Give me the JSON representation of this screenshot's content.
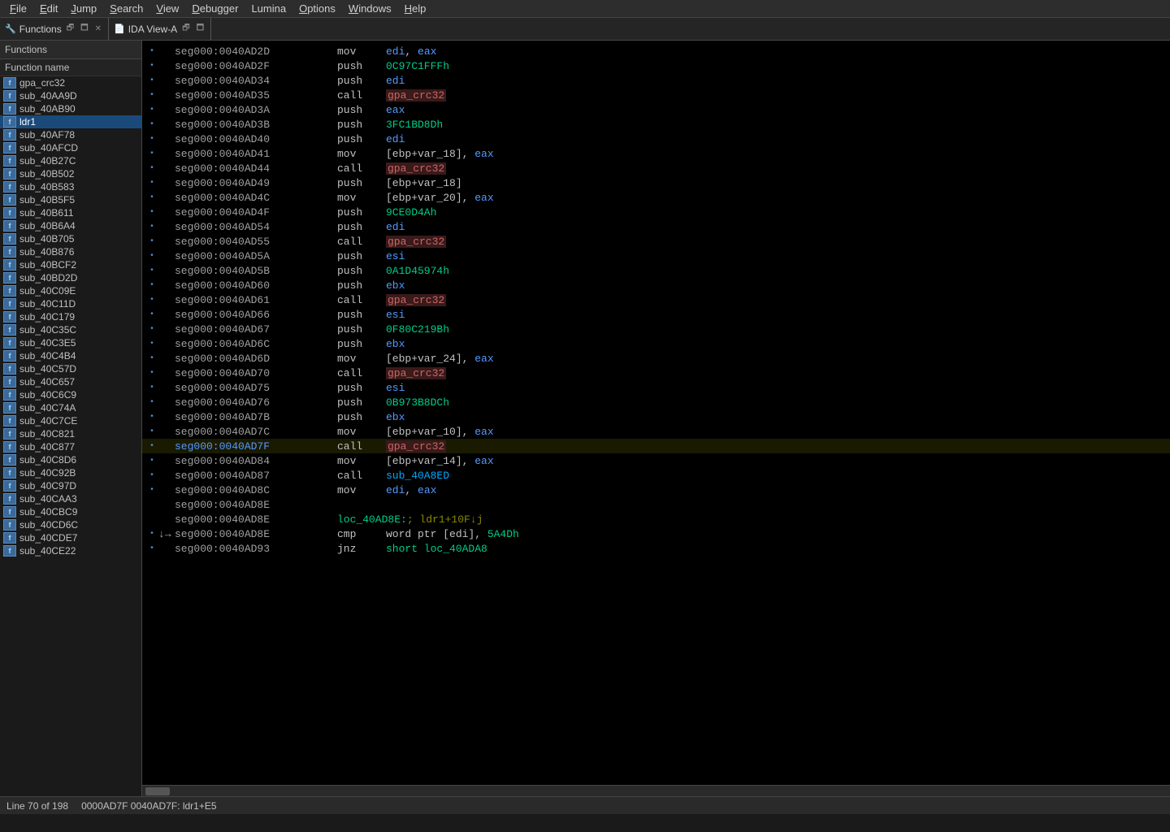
{
  "menubar": {
    "items": [
      {
        "label": "File",
        "underline_index": 0
      },
      {
        "label": "Edit",
        "underline_index": 0
      },
      {
        "label": "Jump",
        "underline_index": 0
      },
      {
        "label": "Search",
        "underline_index": 0
      },
      {
        "label": "View",
        "underline_index": 0
      },
      {
        "label": "Debugger",
        "underline_index": 0
      },
      {
        "label": "Lumina",
        "underline_index": 0
      },
      {
        "label": "Options",
        "underline_index": 0
      },
      {
        "label": "Windows",
        "underline_index": 0
      },
      {
        "label": "Help",
        "underline_index": 0
      }
    ]
  },
  "functions_tab": {
    "icon": "🔧",
    "title": "Functions",
    "col_header": "Function name"
  },
  "ida_view_tab": {
    "title": "IDA View-A"
  },
  "functions_list": [
    "gpa_crc32",
    "sub_40AA9D",
    "sub_40AB90",
    "ldr1",
    "sub_40AF78",
    "sub_40AFCD",
    "sub_40B27C",
    "sub_40B502",
    "sub_40B583",
    "sub_40B5F5",
    "sub_40B611",
    "sub_40B6A4",
    "sub_40B705",
    "sub_40B876",
    "sub_40BCF2",
    "sub_40BD2D",
    "sub_40C09E",
    "sub_40C11D",
    "sub_40C179",
    "sub_40C35C",
    "sub_40C3E5",
    "sub_40C4B4",
    "sub_40C57D",
    "sub_40C657",
    "sub_40C6C9",
    "sub_40C74A",
    "sub_40C7CE",
    "sub_40C821",
    "sub_40C877",
    "sub_40C8D6",
    "sub_40C92B",
    "sub_40C97D",
    "sub_40CAA3",
    "sub_40CBC9",
    "sub_40CD6C",
    "sub_40CDE7",
    "sub_40CE22"
  ],
  "asm_rows": [
    {
      "addr": "seg000:0040AD2D",
      "mnemonic": "mov",
      "operands": [
        {
          "text": "edi",
          "class": "col-reg"
        },
        {
          "text": ", "
        },
        {
          "text": "eax",
          "class": "col-reg"
        }
      ],
      "bullet": true
    },
    {
      "addr": "seg000:0040AD2F",
      "mnemonic": "push",
      "operands": [
        {
          "text": "0C97C1FFFh",
          "class": "col-hex"
        }
      ],
      "bullet": true
    },
    {
      "addr": "seg000:0040AD34",
      "mnemonic": "push",
      "operands": [
        {
          "text": "edi",
          "class": "col-reg"
        }
      ],
      "bullet": true
    },
    {
      "addr": "seg000:0040AD35",
      "mnemonic": "call",
      "operands": [
        {
          "text": "gpa_crc32",
          "class": "col-func"
        }
      ],
      "bullet": true
    },
    {
      "addr": "seg000:0040AD3A",
      "mnemonic": "push",
      "operands": [
        {
          "text": "eax",
          "class": "col-reg"
        }
      ],
      "bullet": true
    },
    {
      "addr": "seg000:0040AD3B",
      "mnemonic": "push",
      "operands": [
        {
          "text": "3FC1BD8Dh",
          "class": "col-hex"
        }
      ],
      "bullet": true
    },
    {
      "addr": "seg000:0040AD40",
      "mnemonic": "push",
      "operands": [
        {
          "text": "edi",
          "class": "col-reg"
        }
      ],
      "bullet": true
    },
    {
      "addr": "seg000:0040AD41",
      "mnemonic": "mov",
      "operands": [
        {
          "text": "[ebp+var_18]",
          "class": "col-mem"
        },
        {
          "text": ", "
        },
        {
          "text": "eax",
          "class": "col-reg"
        }
      ],
      "bullet": true
    },
    {
      "addr": "seg000:0040AD44",
      "mnemonic": "call",
      "operands": [
        {
          "text": "gpa_crc32",
          "class": "col-func"
        }
      ],
      "bullet": true
    },
    {
      "addr": "seg000:0040AD49",
      "mnemonic": "push",
      "operands": [
        {
          "text": "[ebp+var_18]",
          "class": "col-mem"
        }
      ],
      "bullet": true
    },
    {
      "addr": "seg000:0040AD4C",
      "mnemonic": "mov",
      "operands": [
        {
          "text": "[ebp+var_20]",
          "class": "col-mem"
        },
        {
          "text": ", "
        },
        {
          "text": "eax",
          "class": "col-reg"
        }
      ],
      "bullet": true
    },
    {
      "addr": "seg000:0040AD4F",
      "mnemonic": "push",
      "operands": [
        {
          "text": "9CE0D4Ah",
          "class": "col-hex"
        }
      ],
      "bullet": true
    },
    {
      "addr": "seg000:0040AD54",
      "mnemonic": "push",
      "operands": [
        {
          "text": "edi",
          "class": "col-reg"
        }
      ],
      "bullet": true
    },
    {
      "addr": "seg000:0040AD55",
      "mnemonic": "call",
      "operands": [
        {
          "text": "gpa_crc32",
          "class": "col-func"
        }
      ],
      "bullet": true
    },
    {
      "addr": "seg000:0040AD5A",
      "mnemonic": "push",
      "operands": [
        {
          "text": "esi",
          "class": "col-reg"
        }
      ],
      "bullet": true
    },
    {
      "addr": "seg000:0040AD5B",
      "mnemonic": "push",
      "operands": [
        {
          "text": "0A1D45974h",
          "class": "col-hex"
        }
      ],
      "bullet": true
    },
    {
      "addr": "seg000:0040AD60",
      "mnemonic": "push",
      "operands": [
        {
          "text": "ebx",
          "class": "col-reg"
        }
      ],
      "bullet": true
    },
    {
      "addr": "seg000:0040AD61",
      "mnemonic": "call",
      "operands": [
        {
          "text": "gpa_crc32",
          "class": "col-func"
        }
      ],
      "bullet": true
    },
    {
      "addr": "seg000:0040AD66",
      "mnemonic": "push",
      "operands": [
        {
          "text": "esi",
          "class": "col-reg"
        }
      ],
      "bullet": true
    },
    {
      "addr": "seg000:0040AD67",
      "mnemonic": "push",
      "operands": [
        {
          "text": "0F80C219Bh",
          "class": "col-hex"
        }
      ],
      "bullet": true
    },
    {
      "addr": "seg000:0040AD6C",
      "mnemonic": "push",
      "operands": [
        {
          "text": "ebx",
          "class": "col-reg"
        }
      ],
      "bullet": true
    },
    {
      "addr": "seg000:0040AD6D",
      "mnemonic": "mov",
      "operands": [
        {
          "text": "[ebp+var_24]",
          "class": "col-mem"
        },
        {
          "text": ", "
        },
        {
          "text": "eax",
          "class": "col-reg"
        }
      ],
      "bullet": true
    },
    {
      "addr": "seg000:0040AD70",
      "mnemonic": "call",
      "operands": [
        {
          "text": "gpa_crc32",
          "class": "col-func"
        }
      ],
      "bullet": true
    },
    {
      "addr": "seg000:0040AD75",
      "mnemonic": "push",
      "operands": [
        {
          "text": "esi",
          "class": "col-reg"
        }
      ],
      "bullet": true
    },
    {
      "addr": "seg000:0040AD76",
      "mnemonic": "push",
      "operands": [
        {
          "text": "0B973B8DCh",
          "class": "col-hex"
        }
      ],
      "bullet": true
    },
    {
      "addr": "seg000:0040AD7B",
      "mnemonic": "push",
      "operands": [
        {
          "text": "ebx",
          "class": "col-reg"
        }
      ],
      "bullet": true
    },
    {
      "addr": "seg000:0040AD7C",
      "mnemonic": "mov",
      "operands": [
        {
          "text": "[ebp+var_10]",
          "class": "col-mem"
        },
        {
          "text": ", "
        },
        {
          "text": "eax",
          "class": "col-reg"
        }
      ],
      "bullet": true
    },
    {
      "addr": "seg000:0040AD7F",
      "mnemonic": "call",
      "operands": [
        {
          "text": "gpa_crc32",
          "class": "col-func"
        }
      ],
      "bullet": true,
      "current": true
    },
    {
      "addr": "seg000:0040AD84",
      "mnemonic": "mov",
      "operands": [
        {
          "text": "[ebp+var_14]",
          "class": "col-mem"
        },
        {
          "text": ", "
        },
        {
          "text": "eax",
          "class": "col-reg"
        }
      ],
      "bullet": true
    },
    {
      "addr": "seg000:0040AD87",
      "mnemonic": "call",
      "operands": [
        {
          "text": "sub_40A8ED",
          "class": "col-sub"
        }
      ],
      "bullet": true
    },
    {
      "addr": "seg000:0040AD8C",
      "mnemonic": "mov",
      "operands": [
        {
          "text": "edi",
          "class": "col-reg"
        },
        {
          "text": ", "
        },
        {
          "text": "eax",
          "class": "col-reg"
        }
      ],
      "bullet": true
    },
    {
      "addr": "seg000:0040AD8E",
      "mnemonic": "",
      "operands": [],
      "bullet": false
    },
    {
      "addr": "seg000:0040AD8E",
      "label": "loc_40AD8E:",
      "comment": "; ldr1+10F↓j",
      "bullet": false
    },
    {
      "addr": "seg000:0040AD8E",
      "mnemonic": "cmp",
      "operands": [
        {
          "text": "word ptr [edi]",
          "class": "col-mem"
        },
        {
          "text": ", "
        },
        {
          "text": "5A4Dh",
          "class": "col-hex"
        }
      ],
      "bullet": true
    },
    {
      "addr": "seg000:0040AD93",
      "mnemonic": "jnz",
      "operands": [
        {
          "text": "short loc_40ADA8",
          "class": "col-label"
        }
      ],
      "bullet": true
    }
  ],
  "statusbar": {
    "position": "0000AD7F 0040AD7F: ldr1+E5",
    "line_info": "Line 70 of 198"
  },
  "colors": {
    "func_bg": "#3a1a1a",
    "func_text": "#cc6666",
    "reg_text": "#5599ff",
    "hex_text": "#00cc88",
    "sub_text": "#00aaff",
    "label_text": "#00cc88",
    "comment_text": "#888800",
    "current_addr": "#5599ff"
  }
}
